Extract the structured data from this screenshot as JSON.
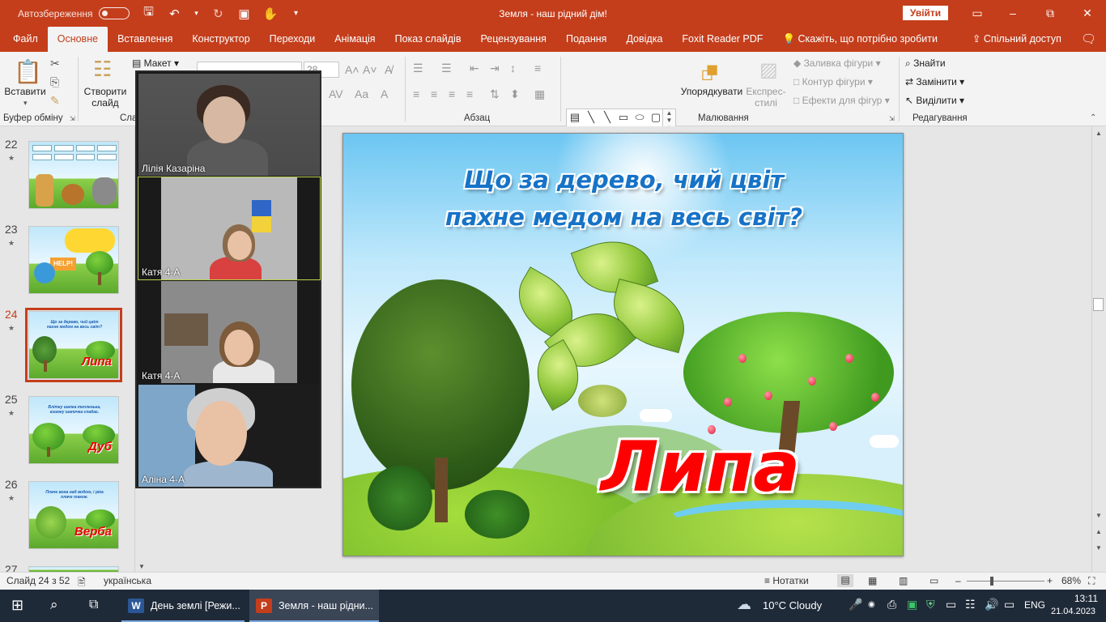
{
  "window": {
    "title": "Земля - наш рідний дім!",
    "autosave_label": "Автозбереження",
    "signin_label": "Увійти",
    "quick_access": [
      "save-icon",
      "undo-icon",
      "redo-icon",
      "present-icon",
      "touch-mode-icon",
      "customize-icon"
    ]
  },
  "tabs": [
    {
      "label": "Файл"
    },
    {
      "label": "Основне"
    },
    {
      "label": "Вставлення"
    },
    {
      "label": "Конструктор"
    },
    {
      "label": "Переходи"
    },
    {
      "label": "Анімація"
    },
    {
      "label": "Показ слайдів"
    },
    {
      "label": "Рецензування"
    },
    {
      "label": "Подання"
    },
    {
      "label": "Довідка"
    },
    {
      "label": "Foxit Reader PDF"
    }
  ],
  "active_tab": "Основне",
  "tell_me": "Скажіть, що потрібно зробити",
  "share_label": "Спільний доступ",
  "ribbon": {
    "clipboard": {
      "paste": "Вставити",
      "group": "Буфер обміну"
    },
    "slides": {
      "new_slide": "Створити слайд",
      "layout": "Макет",
      "group_partial": "Сла"
    },
    "font": {
      "font_size": "28"
    },
    "paragraph": {
      "group": "Абзац"
    },
    "drawing": {
      "arrange": "Упорядкувати",
      "quick_styles": "Експрес-стилі",
      "fill": "Заливка фігури",
      "outline": "Контур фігури",
      "effects": "Ефекти для фігур",
      "group": "Малювання"
    },
    "editing": {
      "find": "Знайти",
      "replace": "Замінити",
      "select": "Виділити",
      "group": "Редагування"
    }
  },
  "thumbnails": [
    {
      "num": "22",
      "text": ""
    },
    {
      "num": "23",
      "text": ""
    },
    {
      "num": "24",
      "text": "Що за дерево, чий цвіт пахне медом на весь світ?",
      "word": "Липа",
      "active": true
    },
    {
      "num": "25",
      "text": "Влітку шапка тепленька, взимку шапочка спадає.",
      "word": "Дуб"
    },
    {
      "num": "26",
      "text": "Плаче вона над водою, і ріка плаче також.",
      "word": "Верба"
    },
    {
      "num": "27",
      "text": ""
    }
  ],
  "video_call": {
    "participants": [
      {
        "name": "Лілія Казаріна"
      },
      {
        "name": "Катя  4-А"
      },
      {
        "name": "Катя 4-А"
      },
      {
        "name": "Аліна 4-А"
      }
    ]
  },
  "slide": {
    "riddle_line1": "Що за дерево, чий цвіт",
    "riddle_line2": "пахне медом на весь світ?",
    "answer": "Липа"
  },
  "status": {
    "slide_info": "Слайд 24 з 52",
    "language": "українська",
    "notes": "Нотатки",
    "zoom": "68%",
    "zoom_level": 0.68
  },
  "taskbar": {
    "apps": [
      {
        "label": "День землі [Режи...",
        "badge": "W"
      },
      {
        "label": "Земля - наш рідни...",
        "badge": "P"
      }
    ],
    "weather": "10°C  Cloudy",
    "lang": "ENG",
    "time": "13:11",
    "date": "21.04.2023"
  },
  "colors": {
    "accent": "#c43e1c",
    "answer": "#ff0000",
    "riddle": "#1673c7"
  }
}
